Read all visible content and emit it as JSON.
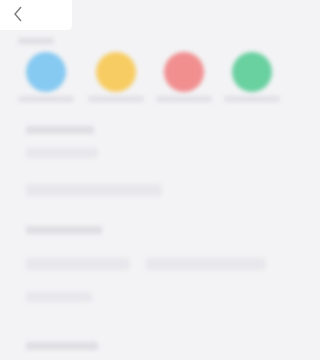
{
  "header": {
    "back_icon": "chevron-left-icon"
  },
  "colors": {
    "background": "#f3f3f5",
    "blue": "#86c9f1",
    "yellow": "#f7cc62",
    "red": "#f18f8f",
    "green": "#69d0a0"
  },
  "category_icons": [
    {
      "icon": "blue-circle-icon"
    },
    {
      "icon": "yellow-circle-icon"
    },
    {
      "icon": "red-circle-icon"
    },
    {
      "icon": "green-circle-icon"
    }
  ]
}
